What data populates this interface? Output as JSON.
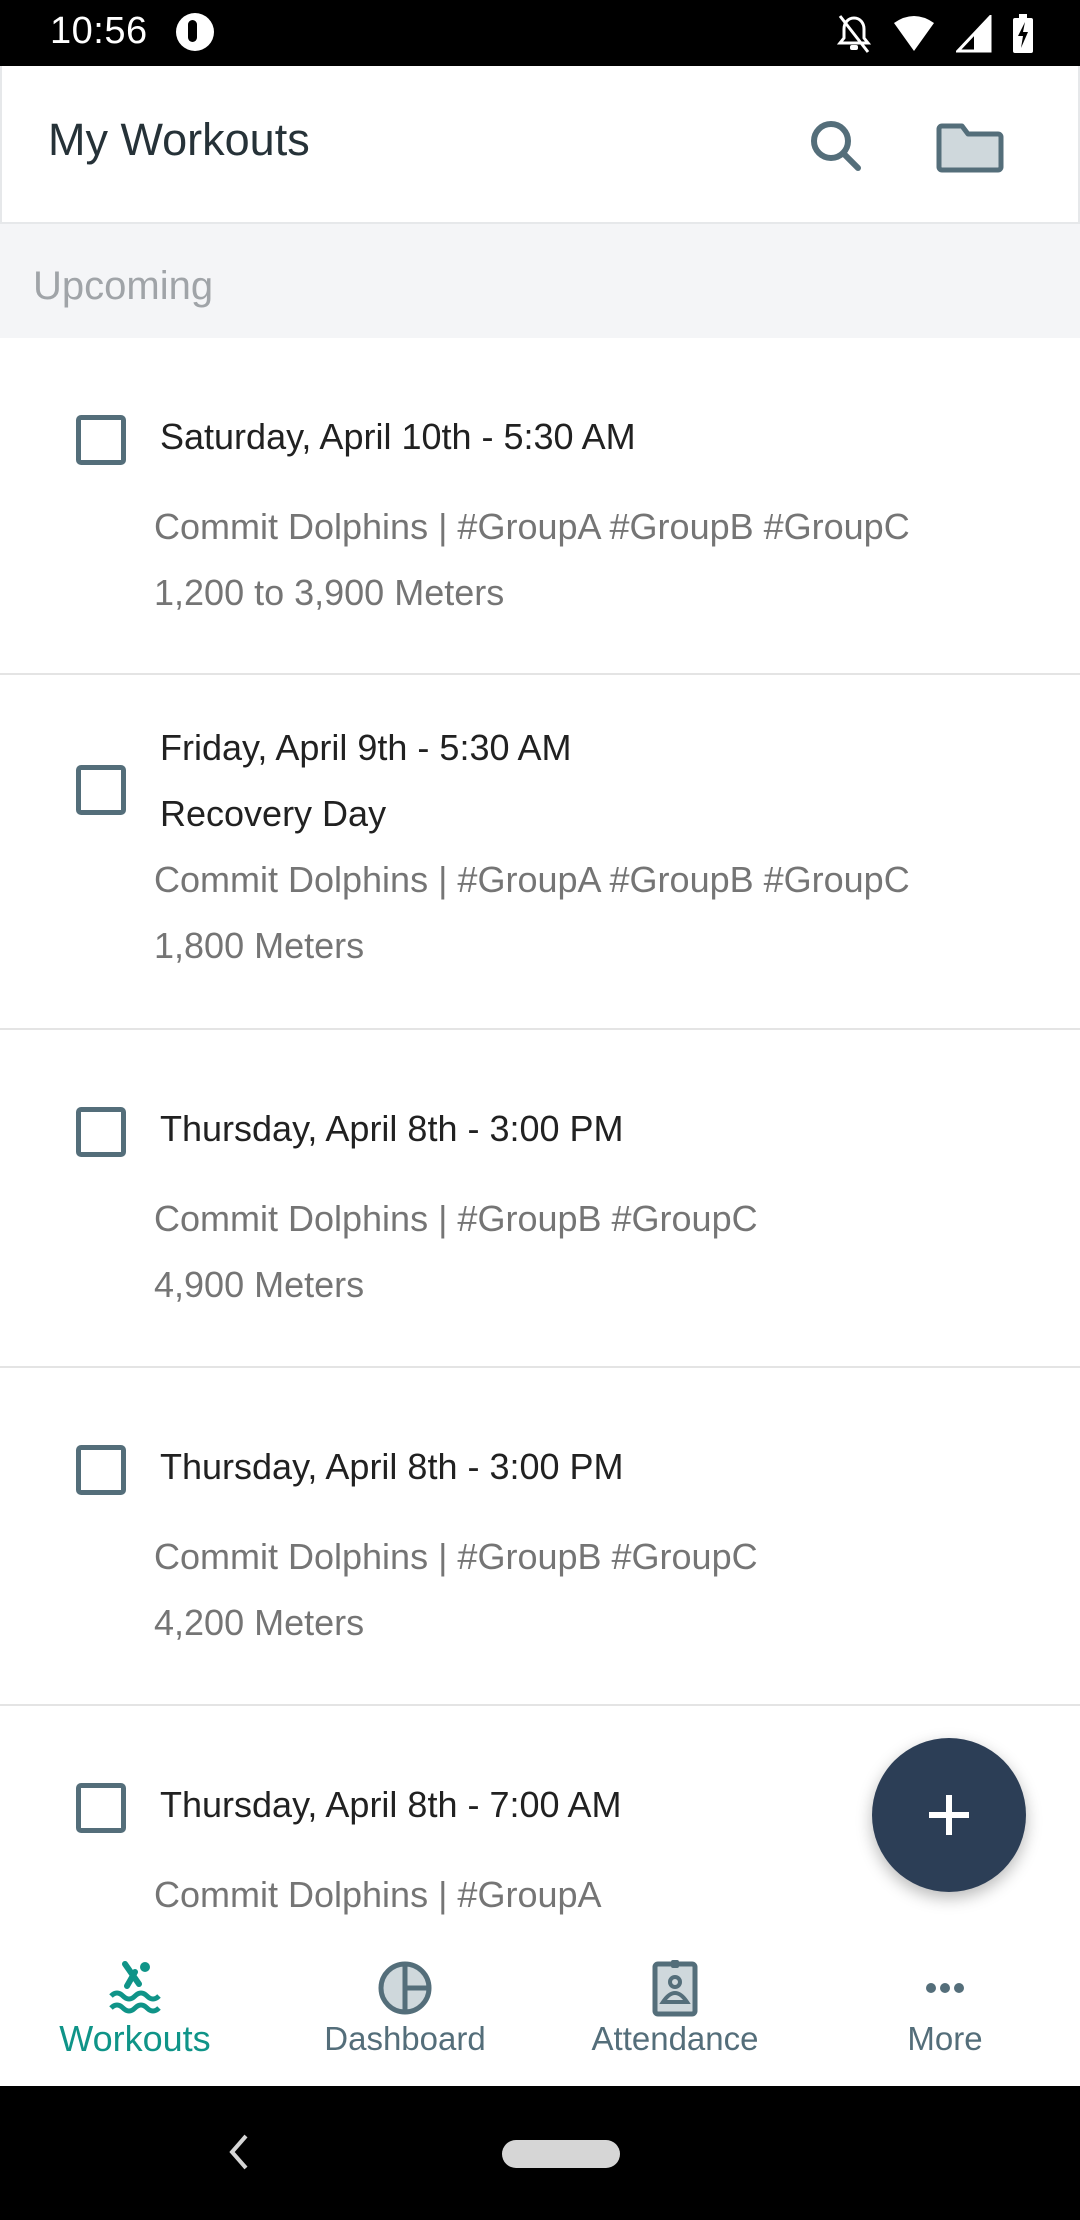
{
  "status_bar": {
    "time": "10:56",
    "icons": [
      "app-notification-icon",
      "bell-off-icon",
      "wifi-icon",
      "signal-icon",
      "battery-charging-icon"
    ]
  },
  "app_bar": {
    "title": "My Workouts",
    "actions": [
      "search-icon",
      "folder-icon"
    ]
  },
  "section": {
    "title": "Upcoming"
  },
  "workouts": [
    {
      "checked": false,
      "title": "Saturday, April 10th - 5:30 AM",
      "subtitle": "",
      "team_groups": "Commit Dolphins | #GroupA #GroupB #GroupC",
      "distance": "1,200 to 3,900 Meters"
    },
    {
      "checked": false,
      "title": "Friday, April 9th - 5:30 AM",
      "subtitle": "Recovery Day",
      "team_groups": "Commit Dolphins | #GroupA #GroupB #GroupC",
      "distance": "1,800 Meters"
    },
    {
      "checked": false,
      "title": "Thursday, April 8th - 3:00 PM",
      "subtitle": "",
      "team_groups": "Commit Dolphins | #GroupB #GroupC",
      "distance": "4,900 Meters"
    },
    {
      "checked": false,
      "title": "Thursday, April 8th - 3:00 PM",
      "subtitle": "",
      "team_groups": "Commit Dolphins | #GroupB #GroupC",
      "distance": "4,200 Meters"
    },
    {
      "checked": false,
      "title": "Thursday, April 8th - 7:00 AM",
      "subtitle": "",
      "team_groups": "Commit Dolphins | #GroupA",
      "distance": ""
    }
  ],
  "fab": {
    "icon": "plus-icon"
  },
  "bottom_nav": {
    "items": [
      {
        "label": "Workouts",
        "icon": "swimmer-icon",
        "active": true
      },
      {
        "label": "Dashboard",
        "icon": "pie-chart-icon",
        "active": false
      },
      {
        "label": "Attendance",
        "icon": "badge-icon",
        "active": false
      },
      {
        "label": "More",
        "icon": "more-horizontal-icon",
        "active": false
      }
    ]
  },
  "colors": {
    "accent": "#0f9488",
    "icon_gray": "#546e7a",
    "fab": "#2c3e56",
    "title_text": "#263238",
    "meta_text": "#757575",
    "section_bg": "#f4f5f7"
  }
}
